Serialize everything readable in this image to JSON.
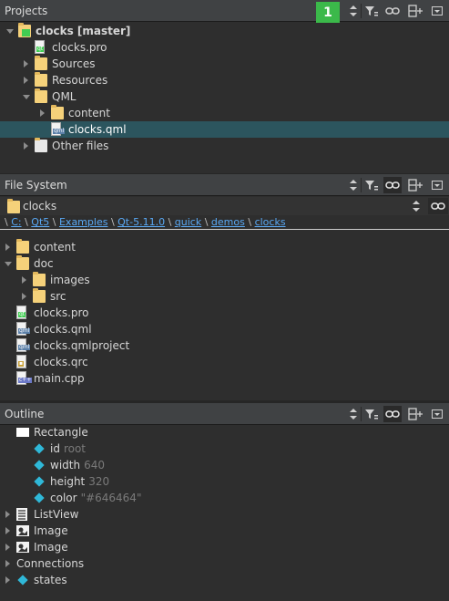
{
  "projects": {
    "title": "Projects",
    "badge": "1",
    "tree": [
      {
        "label": "clocks [master]",
        "depth": 0,
        "arrow": "down",
        "icon": "qt-project-icon",
        "bold": true
      },
      {
        "label": "clocks.pro",
        "depth": 1,
        "arrow": "none",
        "icon": "pro-file-icon"
      },
      {
        "label": "Sources",
        "depth": 1,
        "arrow": "right",
        "icon": "sources-folder-icon"
      },
      {
        "label": "Resources",
        "depth": 1,
        "arrow": "right",
        "icon": "resources-folder-icon"
      },
      {
        "label": "QML",
        "depth": 1,
        "arrow": "down",
        "icon": "qml-folder-icon"
      },
      {
        "label": "content",
        "depth": 2,
        "arrow": "right",
        "icon": "folder-icon"
      },
      {
        "label": "clocks.qml",
        "depth": 2,
        "arrow": "none",
        "icon": "qml-file-icon",
        "selected": true
      },
      {
        "label": "Other files",
        "depth": 1,
        "arrow": "right",
        "icon": "other-files-icon"
      }
    ]
  },
  "filesystem": {
    "title": "File System",
    "combo_value": "clocks",
    "breadcrumb": [
      "C:",
      "Qt5",
      "Examples",
      "Qt-5.11.0",
      "quick",
      "demos",
      "clocks"
    ],
    "tree": [
      {
        "label": "content",
        "depth": 0,
        "arrow": "right",
        "icon": "folder-icon"
      },
      {
        "label": "doc",
        "depth": 0,
        "arrow": "down",
        "icon": "folder-icon"
      },
      {
        "label": "images",
        "depth": 1,
        "arrow": "right",
        "icon": "folder-icon"
      },
      {
        "label": "src",
        "depth": 1,
        "arrow": "right",
        "icon": "folder-icon"
      },
      {
        "label": "clocks.pro",
        "depth": 0,
        "arrow": "none",
        "icon": "pro-file-icon"
      },
      {
        "label": "clocks.qml",
        "depth": 0,
        "arrow": "none",
        "icon": "qml-file-icon"
      },
      {
        "label": "clocks.qmlproject",
        "depth": 0,
        "arrow": "none",
        "icon": "qmlproject-file-icon"
      },
      {
        "label": "clocks.qrc",
        "depth": 0,
        "arrow": "none",
        "icon": "qrc-file-icon"
      },
      {
        "label": "main.cpp",
        "depth": 0,
        "arrow": "none",
        "icon": "cpp-file-icon"
      }
    ]
  },
  "outline": {
    "title": "Outline",
    "tree": [
      {
        "label": "Rectangle",
        "depth": 0,
        "arrow": "none",
        "icon": "rectangle-icon"
      },
      {
        "label": "id",
        "value": "root",
        "depth": 1,
        "arrow": "none",
        "icon": "property-icon"
      },
      {
        "label": "width",
        "value": "640",
        "depth": 1,
        "arrow": "none",
        "icon": "property-icon"
      },
      {
        "label": "height",
        "value": "320",
        "depth": 1,
        "arrow": "none",
        "icon": "property-icon"
      },
      {
        "label": "color",
        "value": "\"#646464\"",
        "depth": 1,
        "arrow": "none",
        "icon": "property-icon"
      },
      {
        "label": "ListView",
        "depth": 0,
        "arrow": "right",
        "icon": "listview-icon"
      },
      {
        "label": "Image",
        "depth": 0,
        "arrow": "right",
        "icon": "image-icon"
      },
      {
        "label": "Image",
        "depth": 0,
        "arrow": "right",
        "icon": "image-icon"
      },
      {
        "label": "Connections",
        "depth": 0,
        "arrow": "right",
        "icon": "none"
      },
      {
        "label": "states",
        "depth": 0,
        "arrow": "right",
        "icon": "property-icon"
      }
    ]
  },
  "colors": {
    "selection": "#2c555e",
    "badge": "#3bb94a",
    "link": "#5aa9f5",
    "property_diamond": "#2fb8d8"
  }
}
